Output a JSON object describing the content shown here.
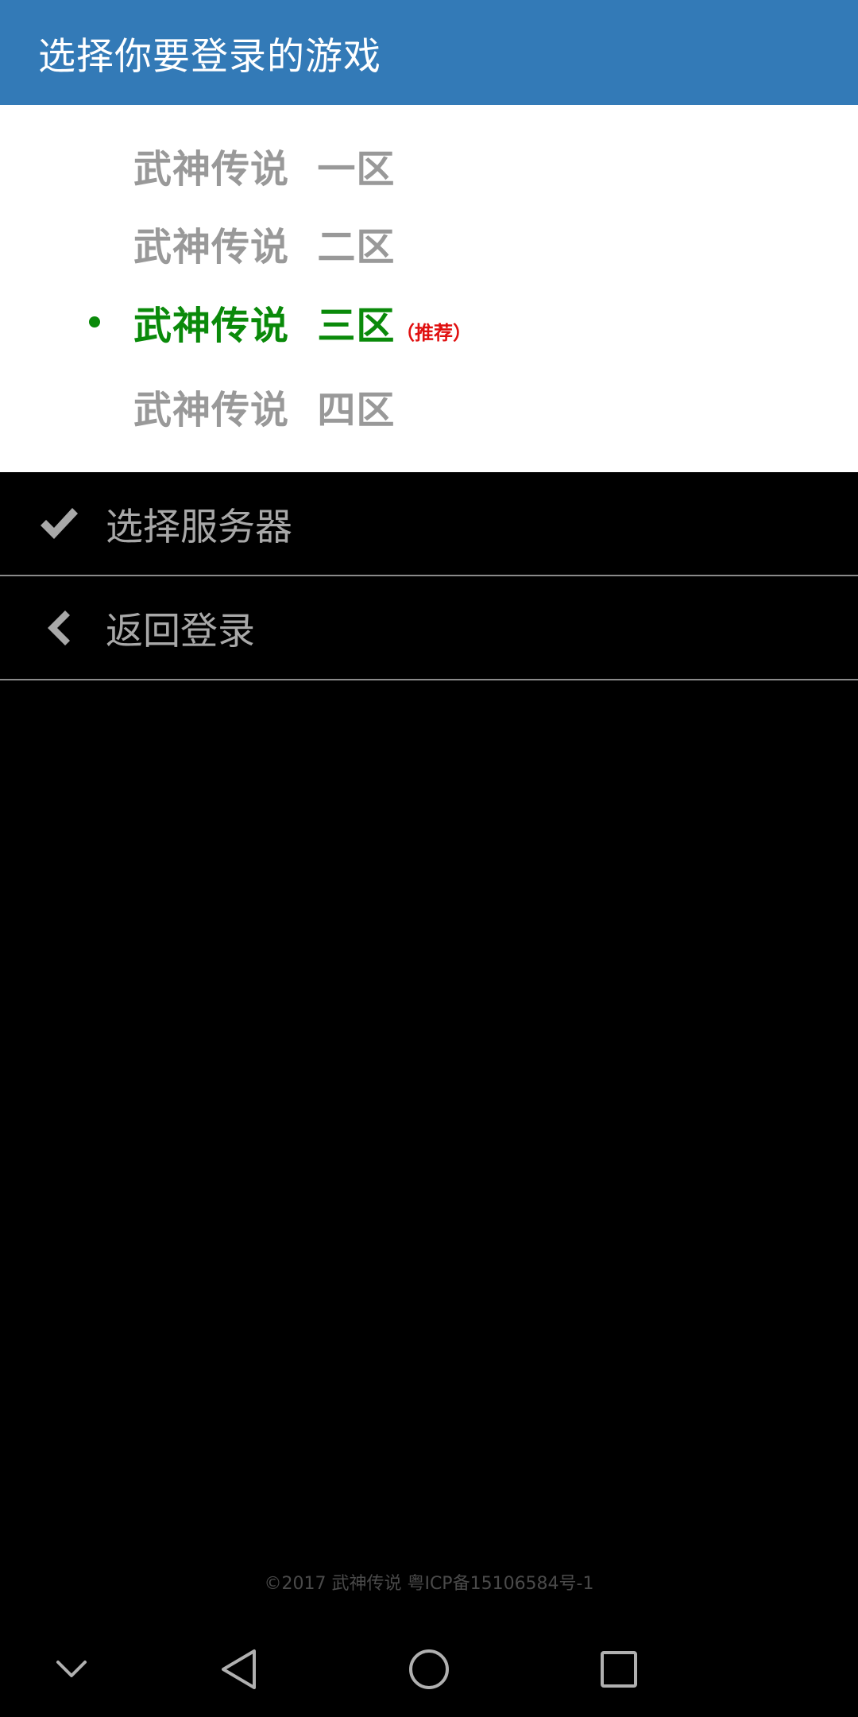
{
  "header": {
    "title": "选择你要登录的游戏"
  },
  "servers": [
    {
      "label": "武神传说  一区",
      "selected": false,
      "tag": ""
    },
    {
      "label": "武神传说  二区",
      "selected": false,
      "tag": ""
    },
    {
      "label": "武神传说  三区",
      "selected": true,
      "tag": "（推荐）"
    },
    {
      "label": "武神传说  四区",
      "selected": false,
      "tag": ""
    }
  ],
  "menu": {
    "select_server": {
      "label": "选择服务器",
      "icon": "checkmark-icon"
    },
    "back_login": {
      "label": "返回登录",
      "icon": "chevron-left-icon"
    }
  },
  "footer": {
    "copyright": "©2017 武神传说 粤ICP备15106584号-1"
  },
  "navbar": {
    "buttons": [
      "chevron-down-icon",
      "back-triangle-icon",
      "home-circle-icon",
      "recents-square-icon"
    ]
  },
  "colors": {
    "header_bg": "#337ab7",
    "selected_server": "#0a8a0a",
    "inactive_server": "#999999",
    "recommend_tag": "#e01010"
  }
}
